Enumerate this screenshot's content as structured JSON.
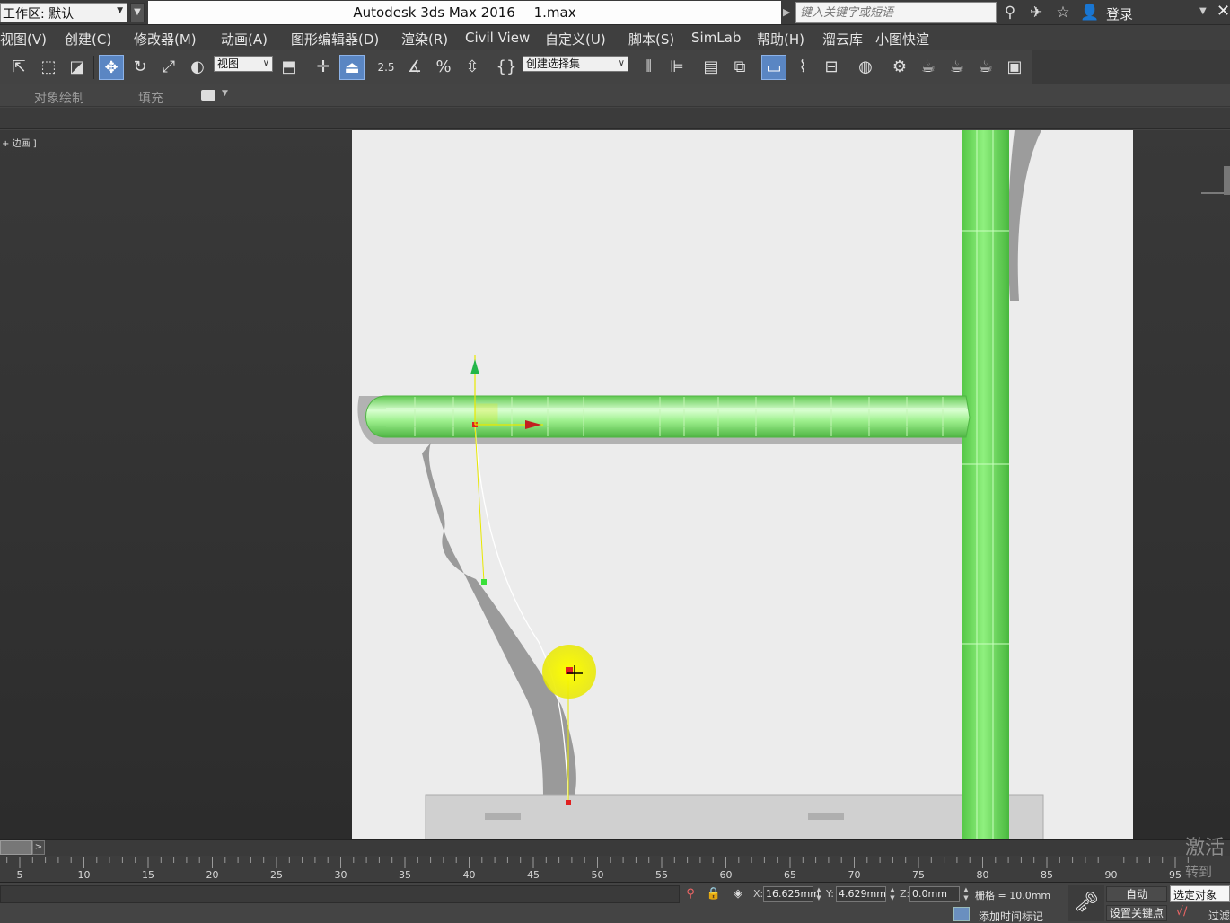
{
  "titlebar": {
    "workspace_label": "工作区: 默认",
    "app_title": "Autodesk 3ds Max 2016",
    "file_name": "1.max",
    "search_placeholder": "键入关键字或短语",
    "login_label": "登录"
  },
  "menu": {
    "items": [
      "视图(V)",
      "创建(C)",
      "修改器(M)",
      "动画(A)",
      "图形编辑器(D)",
      "渲染(R)",
      "Civil View",
      "自定义(U)",
      "脚本(S)",
      "SimLab",
      "帮助(H)",
      "溜云库",
      "小图快渲"
    ]
  },
  "toolbar": {
    "ref_coord_value": "视图",
    "snap_angle_label": "2.5",
    "named_selection_value": "创建选择集"
  },
  "ribbon": {
    "tabs": [
      "对象绘制",
      "填充"
    ]
  },
  "viewport": {
    "label": "+ 边画 ]"
  },
  "timeline": {
    "frame_arrow": ">",
    "ticks": [
      5,
      10,
      15,
      20,
      25,
      30,
      35,
      40,
      45,
      50,
      55,
      60,
      65,
      70,
      75,
      80,
      85,
      90,
      95
    ]
  },
  "status": {
    "x_label": "X:",
    "x_value": "16.625mm",
    "y_label": "Y:",
    "y_value": "4.629mm",
    "z_label": "Z:",
    "z_value": "0.0mm",
    "grid_label": "栅格 = 10.0mm",
    "auto_key_label": "自动",
    "selected_dropdown": "选定对象",
    "set_key_label": "设置关键点",
    "filter_label": "过滤",
    "add_time_tag": "添加时间标记"
  },
  "watermark": {
    "line1": "激活",
    "line2": "转到"
  }
}
